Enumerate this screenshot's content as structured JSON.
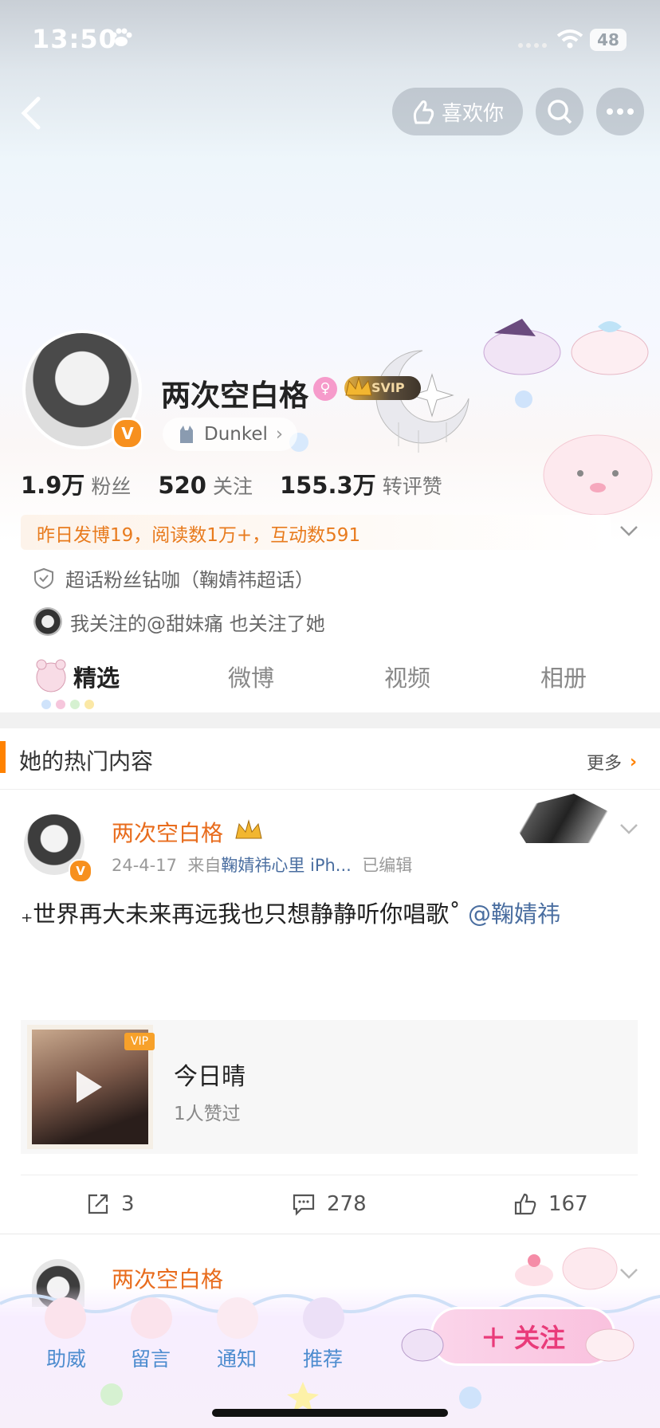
{
  "status": {
    "time": "13:50",
    "battery": "48"
  },
  "nav": {
    "like_label": "喜欢你"
  },
  "profile": {
    "name": "两次空白格",
    "svip": "SVIP",
    "tag": "Dunkel",
    "stats": [
      {
        "num": "1.9万",
        "label": "粉丝"
      },
      {
        "num": "520",
        "label": "关注"
      },
      {
        "num": "155.3万",
        "label": "转评赞"
      }
    ],
    "activity": "昨日发博19，阅读数1万+，互动数591",
    "super_topic": "超话粉丝钻咖（鞠婧祎超话）",
    "mutual": "我关注的@甜妹痛 也关注了她"
  },
  "tabs": [
    "精选",
    "微博",
    "视频",
    "相册"
  ],
  "hot": {
    "title": "她的热门内容",
    "more": "更多",
    "post": {
      "author": "两次空白格",
      "date": "24-4-17",
      "source_prefix": "来自",
      "source": "鞠婧祎心里 iPh...",
      "edited": "已编辑",
      "text": "₊世界再大未来再远我也只想静静听你唱歌˚ ",
      "mention": "@鞠婧祎",
      "music": {
        "title": "今日晴",
        "likes": "1人赞过",
        "badge": "VIP"
      },
      "reposts": "3",
      "comments": "278",
      "likes": "167"
    },
    "post2": {
      "author": "两次空白格"
    }
  },
  "bottom": {
    "tabs": [
      "助威",
      "留言",
      "通知",
      "推荐"
    ],
    "follow": "关注"
  },
  "colors": {
    "accent": "#ff8200",
    "link": "#4a6ea0",
    "bottom_tab": "#4d8ccf",
    "follow_text": "#e93b7a"
  }
}
